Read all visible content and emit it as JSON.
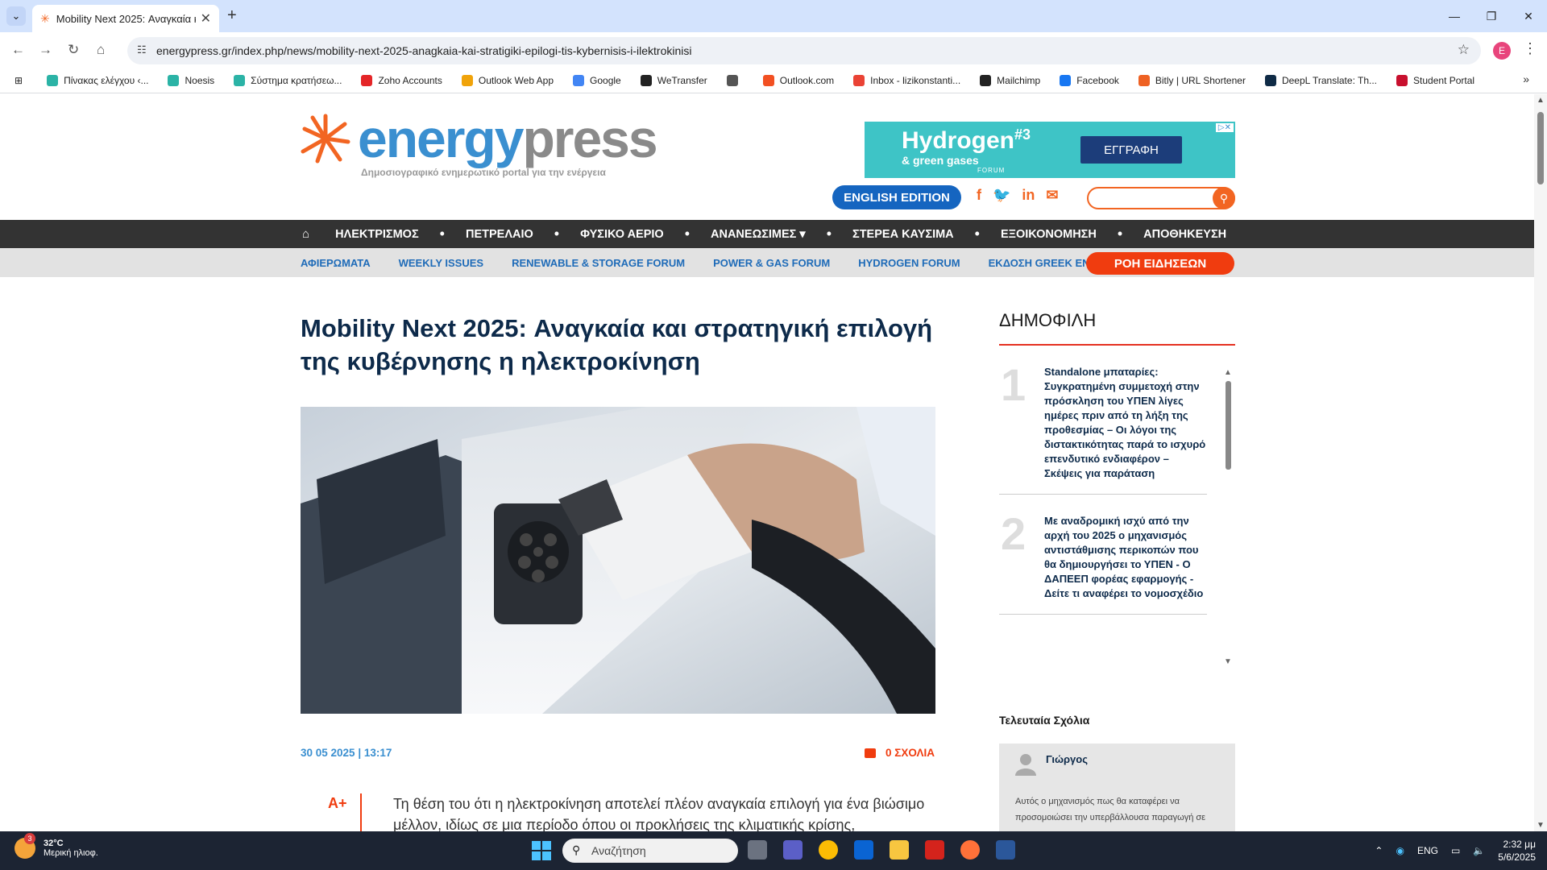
{
  "browser": {
    "tab_title": "Mobility Next 2025: Αναγκαία κ",
    "url": "energypress.gr/index.php/news/mobility-next-2025-anagkaia-kai-stratigiki-epilogi-tis-kybernisis-i-ilektrokinisi",
    "profile_initial": "E",
    "bookmarks": [
      {
        "label": "Πίνακας ελέγχου ‹...",
        "color": "#2bb3a6"
      },
      {
        "label": "Noesis",
        "color": "#2bb3a6"
      },
      {
        "label": "Σύστημα κρατήσεω...",
        "color": "#2bb3a6"
      },
      {
        "label": "Zoho Accounts",
        "color": "#e42527"
      },
      {
        "label": "Outlook Web App",
        "color": "#f0a30a"
      },
      {
        "label": "Google",
        "color": "#4285f4"
      },
      {
        "label": "WeTransfer",
        "color": "#222222"
      },
      {
        "label": "",
        "color": "#555555"
      },
      {
        "label": "Outlook.com",
        "color": "#f25022"
      },
      {
        "label": "Inbox - lizikonstanti...",
        "color": "#ea4335"
      },
      {
        "label": "Mailchimp",
        "color": "#222222"
      },
      {
        "label": "Facebook",
        "color": "#1877f2"
      },
      {
        "label": "Bitly | URL Shortener",
        "color": "#ee6123"
      },
      {
        "label": "DeepL Translate: Th...",
        "color": "#0f2b46"
      },
      {
        "label": "Student Portal",
        "color": "#c8102e"
      }
    ]
  },
  "site": {
    "logo_part1": "energy",
    "logo_part2": "press",
    "tagline": "Δημοσιογραφικό ενημερωτικό portal για την ενέργεια",
    "ad": {
      "headline": "Hydrogen",
      "sup": "#3",
      "sub": "& green gases",
      "forum": "FORUM",
      "button": "ΕΓΓΡΑΦΗ"
    },
    "english_edition": "ENGLISH EDITION",
    "social": [
      "f",
      "t",
      "in",
      "✉"
    ],
    "main_nav": [
      "ΗΛΕΚΤΡΙΣΜΟΣ",
      "ΠΕΤΡΕΛΑΙΟ",
      "ΦΥΣΙΚΟ ΑΕΡΙΟ",
      "ΑΝΑΝΕΩΣΙΜΕΣ ▾",
      "ΣΤΕΡΕΑ ΚΑΥΣΙΜΑ",
      "ΕΞΟΙΚΟΝΟΜΗΣΗ",
      "ΑΠΟΘΗΚΕΥΣΗ"
    ],
    "sub_nav": [
      "ΑΦΙΕΡΩΜΑΤΑ",
      "WEEKLY ISSUES",
      "RENEWABLE & STORAGE FORUM",
      "POWER & GAS FORUM",
      "HYDROGEN FORUM",
      "ΕΚΔΟΣΗ GREEK ENERGY"
    ],
    "news_flow": "ΡΟΗ ΕΙΔΗΣΕΩΝ"
  },
  "article": {
    "title": "Mobility Next 2025: Αναγκαία και στρατηγική επιλογή της κυβέρνησης η ηλεκτροκίνηση",
    "date": "30 05 2025 | 13:17",
    "comments": "0 ΣΧΟΛΙΑ",
    "font_toggle": "A+",
    "body": "Τη θέση του ότι η ηλεκτροκίνηση αποτελεί πλέον αναγκαία επιλογή για ένα βιώσιμο μέλλον, ιδίως σε μια περίοδο όπου οι προκλήσεις της κλιματικής κρίσης,"
  },
  "sidebar": {
    "popular_title": "ΔΗΜΟΦΙΛΗ",
    "popular": [
      {
        "num": "1",
        "text": "Standalone μπαταρίες: Συγκρατημένη συμμετοχή στην πρόσκληση του ΥΠΕΝ λίγες ημέρες πριν από τη λήξη της προθεσμίας – Οι λόγοι της διστακτικότητας παρά το ισχυρό επενδυτικό ενδιαφέρον – Σκέψεις για παράταση"
      },
      {
        "num": "2",
        "text": "Με αναδρομική ισχύ από την αρχή του 2025 ο μηχανισμός αντιστάθμισης περικοπών που θα δημιουργήσει το ΥΠΕΝ - Ο ΔΑΠΕΕΠ φορέας εφαρμογής - Δείτε τι αναφέρει το νομοσχέδιο"
      }
    ],
    "last_comments_title": "Τελευταία Σχόλια",
    "comment": {
      "name": "Γιώργος",
      "text": "Αυτός ο μηχανισμός πως θα καταφέρει να προσομοιώσει την υπερβάλλουσα παραγωγή σε"
    }
  },
  "taskbar": {
    "temp": "32°C",
    "weather": "Μερική ηλιοφ.",
    "weather_badge": "3",
    "search_placeholder": "Αναζήτηση",
    "lang": "ENG",
    "time": "2:32 μμ",
    "date": "5/6/2025"
  }
}
